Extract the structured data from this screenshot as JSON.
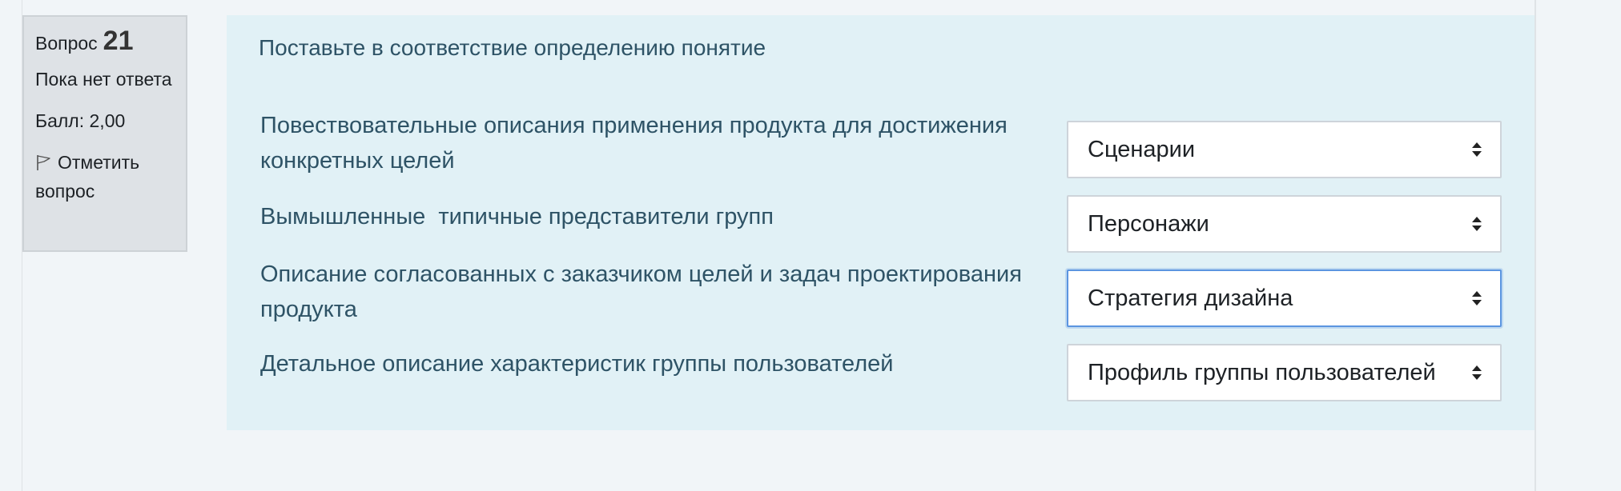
{
  "question_info": {
    "label": "Вопрос",
    "number": "21",
    "state": "Пока нет ответа",
    "grade": "Балл: 2,00",
    "flag_label": "Отметить вопрос"
  },
  "content": {
    "prompt": "Поставьте в соответствие определению понятие",
    "rows": [
      {
        "text": "Повествовательные описания применения продукта для достижения конкретных целей",
        "selected": "Сценарии"
      },
      {
        "text": "Вымышленные  типичные представители групп",
        "selected": "Персонажи"
      },
      {
        "text": "Описание согласованных с заказчиком целей и задач проектирования продукта",
        "selected": "Стратегия дизайна"
      },
      {
        "text": "Детальное описание характеристик группы пользователей",
        "selected": "Профиль группы пользователей"
      }
    ]
  }
}
